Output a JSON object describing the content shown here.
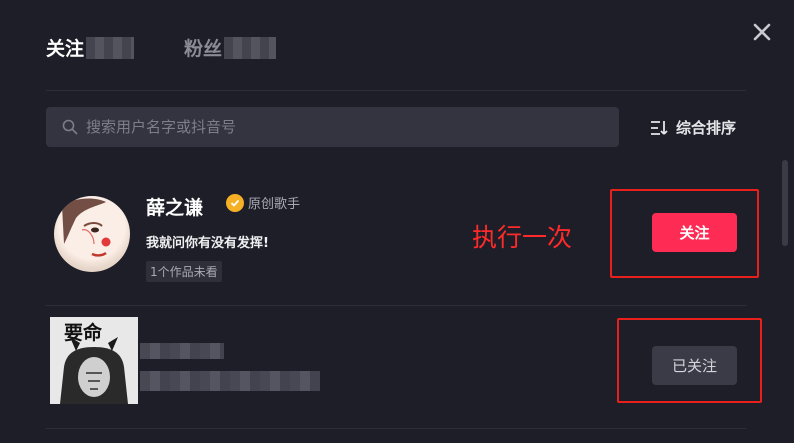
{
  "tabs": [
    {
      "label": "关注",
      "active": true
    },
    {
      "label": "粉丝",
      "active": false
    }
  ],
  "search": {
    "placeholder": "搜索用户名字或抖音号"
  },
  "sort": {
    "label": "综合排序"
  },
  "users": [
    {
      "name": "薛之谦",
      "badge": "原创歌手",
      "bio": "我就问你有没有发挥!",
      "unseen": "1个作品未看",
      "button": "关注"
    },
    {
      "avatar_text": "要命",
      "button": "已关注"
    }
  ],
  "annotation": "执行一次",
  "colors": {
    "background": "#1e1e28",
    "follow_button": "#fe2c55",
    "annotation": "#ff2a2a",
    "badge": "#f6b026"
  }
}
